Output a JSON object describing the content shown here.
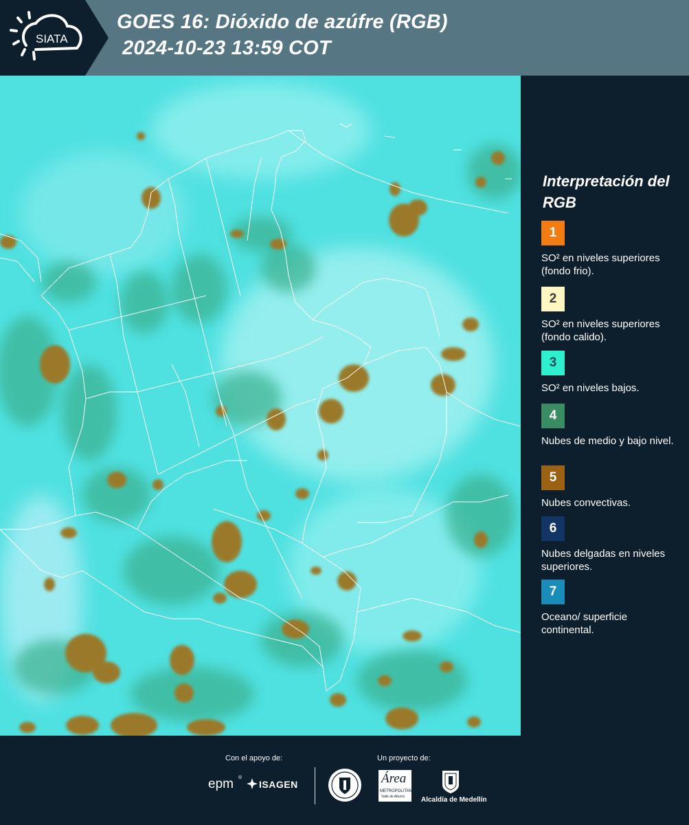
{
  "header": {
    "logo_text": "SIATA",
    "title_line1": "GOES 16: Dióxido de azúfre (RGB)",
    "title_line2": "2024-10-23 13:59 COT"
  },
  "map": {
    "background_color": "#4fe0e0",
    "cloud_color": "#9c7a2e",
    "border_color": "#ffffff"
  },
  "legend": {
    "title": "Interpretación del RGB",
    "items": [
      {
        "number": "1",
        "color": "#f27d12",
        "text": "SO² en niveles superiores (fondo frio)."
      },
      {
        "number": "2",
        "color": "#fff7c2",
        "text": "SO² en niveles superiores (fondo calido)."
      },
      {
        "number": "3",
        "color": "#2ef0cf",
        "text": "SO² en niveles bajos."
      },
      {
        "number": "4",
        "color": "#3a8c62",
        "text": "Nubes de medio y bajo nivel."
      },
      {
        "number": "5",
        "color": "#9a6212",
        "text": "Nubes convectivas."
      },
      {
        "number": "6",
        "color": "#123566",
        "text": "Nubes delgadas en niveles superiores."
      },
      {
        "number": "7",
        "color": "#1a8cb8",
        "text": "Oceano/ superficie continental."
      }
    ]
  },
  "footer": {
    "support_label": "Con el apoyo de:",
    "project_label": "Un proyecto de:",
    "sponsor_epm": "epm",
    "sponsor_isagen": "ISAGEN",
    "area_logo_text": "Área",
    "area_subtext": "METROPOLITANA",
    "area_subtext2": "Valle de Aburrá",
    "alcaldia_text": "Alcaldía de Medellín"
  }
}
